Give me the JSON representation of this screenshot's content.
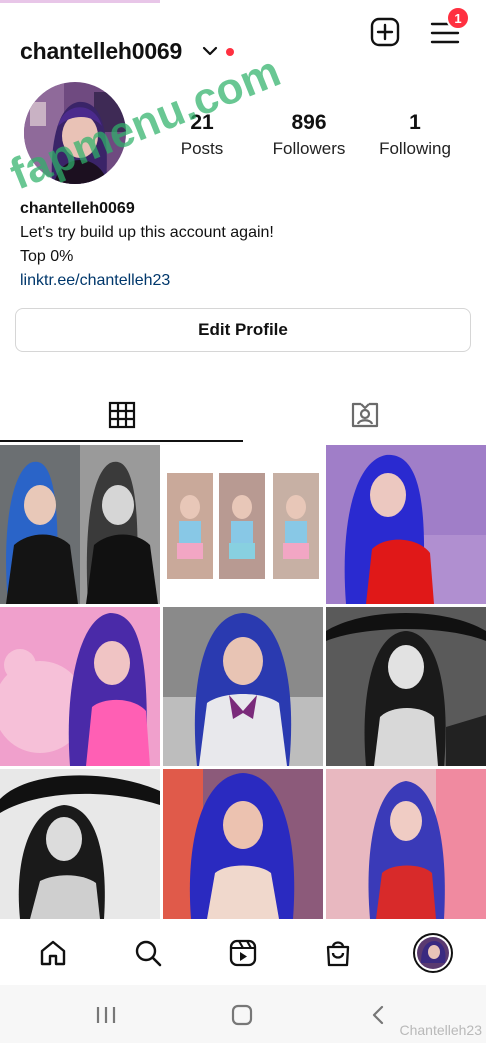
{
  "header": {
    "username": "chantelleh0069",
    "notification_count": "1",
    "accent_color": "#ff3040"
  },
  "stats": {
    "posts": {
      "value": "21",
      "label": "Posts"
    },
    "followers": {
      "value": "896",
      "label": "Followers"
    },
    "following": {
      "value": "1",
      "label": "Following"
    }
  },
  "bio": {
    "name": "chantelleh0069",
    "line1": "Let's try build up this account again!",
    "line2": "Top 0%",
    "link": "linktr.ee/chantelleh23",
    "link_color": "#00376b"
  },
  "edit_profile_label": "Edit Profile",
  "tabs": [
    {
      "icon": "grid-icon",
      "active": true
    },
    {
      "icon": "tagged-icon",
      "active": false
    }
  ],
  "grid_posts": 9,
  "bottom_nav": [
    "home-icon",
    "search-icon",
    "reels-icon",
    "shop-icon",
    "profile-avatar"
  ],
  "watermark": "fapmenu.com",
  "credit": "Chantelleh23"
}
